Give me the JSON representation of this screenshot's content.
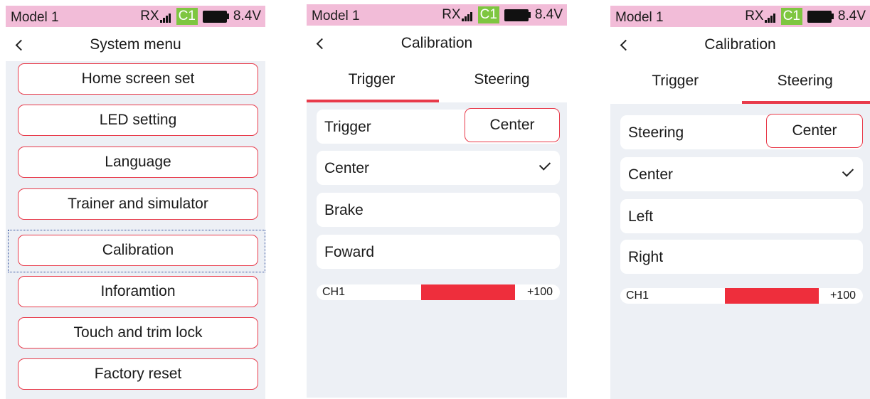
{
  "status_bar": {
    "model_name": "Model 1",
    "rx_label": "RX",
    "channel_badge": "C1",
    "voltage": "8.4V",
    "colors": {
      "bar_bg": "#f2bcd8",
      "badge_bg": "#7ec640"
    }
  },
  "screens": [
    {
      "title": "System menu",
      "menu_items": [
        "Home screen set",
        "LED setting",
        "Language",
        "Trainer and simulator",
        "Calibration",
        "Inforamtion",
        "Touch and trim lock",
        "Factory reset"
      ],
      "focused_item": "Calibration"
    },
    {
      "title": "Calibration",
      "tabs": [
        "Trigger",
        "Steering"
      ],
      "active_tab": "Trigger",
      "row_label": "Trigger",
      "center_button": "Center",
      "options": [
        "Center",
        "Brake",
        "Foward"
      ],
      "checked_option": "Center",
      "channel": {
        "label": "CH1",
        "value": "+100"
      }
    },
    {
      "title": "Calibration",
      "tabs": [
        "Trigger",
        "Steering"
      ],
      "active_tab": "Steering",
      "row_label": "Steering",
      "center_button": "Center",
      "options": [
        "Center",
        "Left",
        "Right"
      ],
      "checked_option": "Center",
      "channel": {
        "label": "CH1",
        "value": "+100"
      }
    }
  ],
  "accent_color": "#e83a4a",
  "icons": [
    "back-chevron-icon",
    "signal-bars-icon",
    "battery-icon",
    "checkmark-icon"
  ]
}
